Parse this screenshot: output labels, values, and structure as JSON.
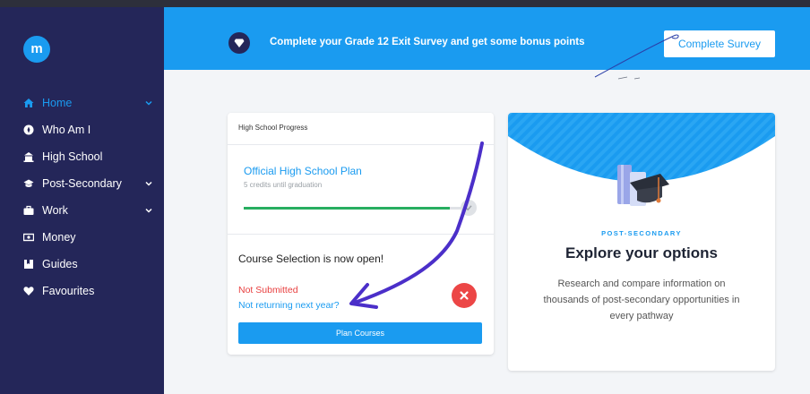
{
  "app": {
    "logo_letter": "m"
  },
  "sidebar": {
    "items": [
      {
        "label": "Home",
        "icon": "home-icon",
        "active": true,
        "has_chevron": true
      },
      {
        "label": "Who Am I",
        "icon": "compass-icon",
        "active": false,
        "has_chevron": false
      },
      {
        "label": "High School",
        "icon": "school-icon",
        "active": false,
        "has_chevron": false
      },
      {
        "label": "Post-Secondary",
        "icon": "graduation-cap-icon",
        "active": false,
        "has_chevron": true
      },
      {
        "label": "Work",
        "icon": "briefcase-icon",
        "active": false,
        "has_chevron": true
      },
      {
        "label": "Money",
        "icon": "money-icon",
        "active": false,
        "has_chevron": false
      },
      {
        "label": "Guides",
        "icon": "book-icon",
        "active": false,
        "has_chevron": false
      },
      {
        "label": "Favourites",
        "icon": "heart-icon",
        "active": false,
        "has_chevron": false
      }
    ]
  },
  "banner": {
    "text": "Complete your Grade 12 Exit Survey and get some bonus points",
    "button_label": "Complete Survey",
    "icon": "diamond-icon"
  },
  "progress_card": {
    "header": "High School Progress",
    "plan_title": "Official High School Plan",
    "plan_subtitle": "5 credits until graduation",
    "progress_fraction": 0.9,
    "course_title": "Course Selection is now open!",
    "status": "Not Submitted",
    "link": "Not returning next year?",
    "button_label": "Plan Courses"
  },
  "explore_card": {
    "kicker": "POST-SECONDARY",
    "title": "Explore your options",
    "description": "Research and compare information on thousands of post-secondary opportunities in every pathway"
  },
  "colors": {
    "brand_blue": "#1a9bf0",
    "sidebar_bg": "#242659",
    "progress_green": "#27ae60",
    "error_red": "#e84040",
    "annotation_purple": "#4b2fc9"
  }
}
